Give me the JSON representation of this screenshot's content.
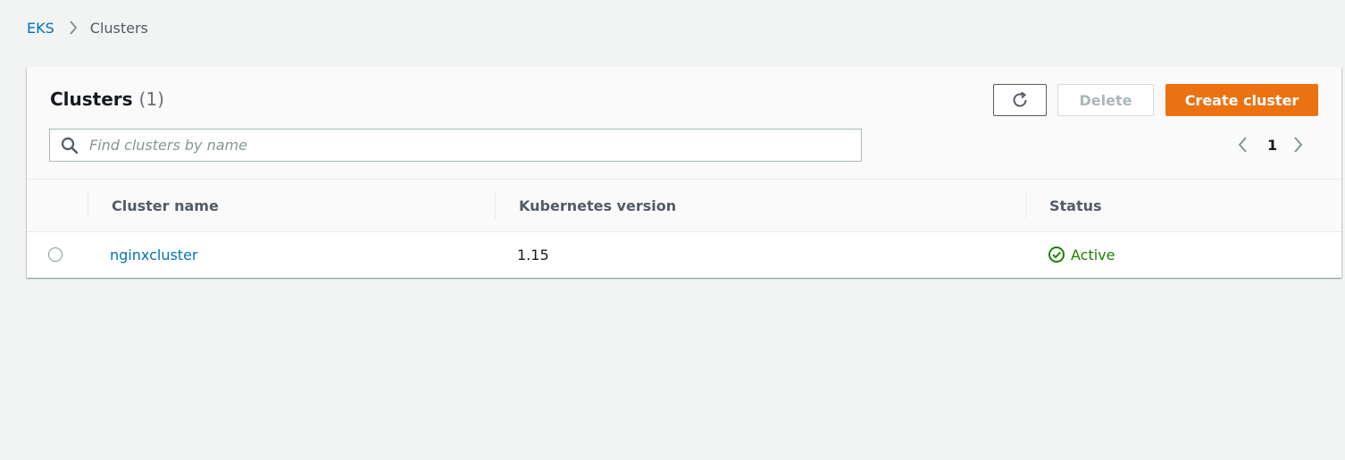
{
  "breadcrumb": {
    "root": "EKS",
    "current": "Clusters"
  },
  "panel": {
    "title": "Clusters",
    "count": "(1)"
  },
  "toolbar": {
    "refresh_icon": "refresh-icon",
    "delete_label": "Delete",
    "create_label": "Create cluster"
  },
  "search": {
    "placeholder": "Find clusters by name",
    "value": ""
  },
  "pagination": {
    "page": "1"
  },
  "table": {
    "columns": [
      "Cluster name",
      "Kubernetes version",
      "Status"
    ],
    "rows": [
      {
        "name": "nginxcluster",
        "version": "1.15",
        "status": "Active"
      }
    ]
  },
  "colors": {
    "accent": "#ec7211",
    "link": "#0073bb",
    "success": "#1d8102"
  }
}
